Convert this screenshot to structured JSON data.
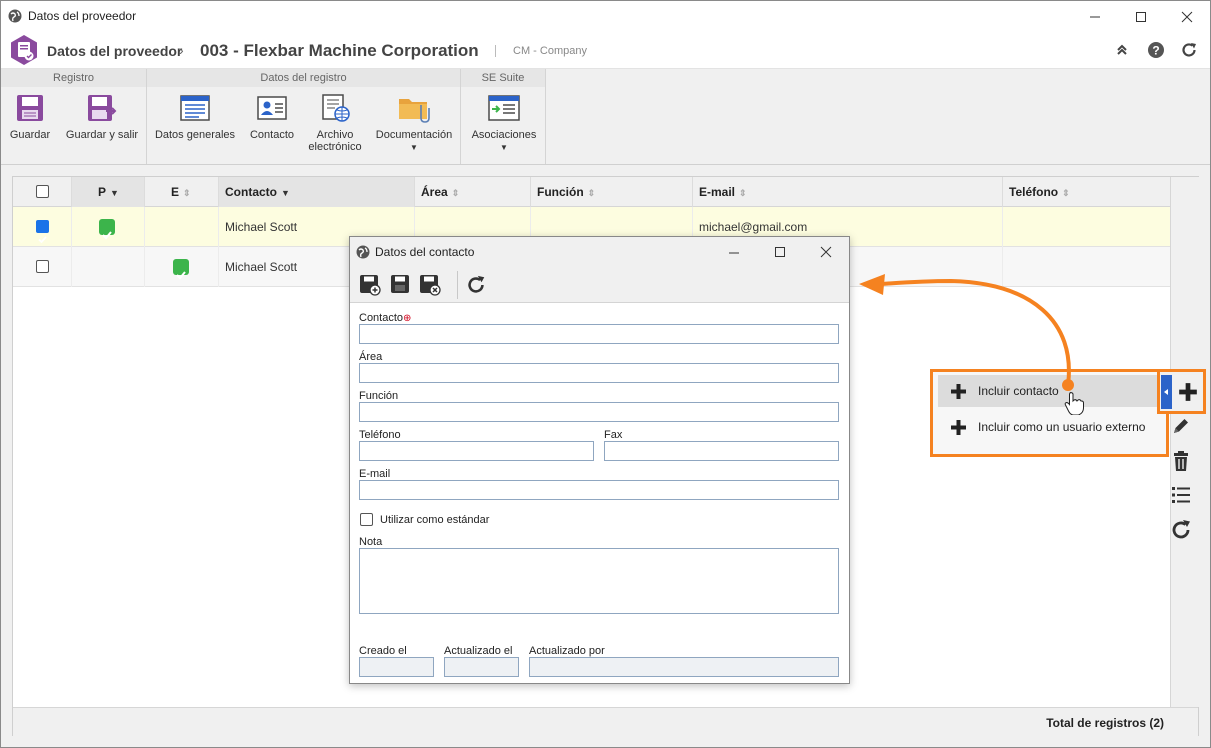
{
  "window": {
    "title": "Datos del proveedor"
  },
  "header": {
    "crumb_root": "Datos del proveedor",
    "crumb_sep": "›",
    "crumb_record": "003 - Flexbar Machine Corporation",
    "separator": "|",
    "context": "CM - Company"
  },
  "ribbon": {
    "groups": [
      {
        "title": "Registro"
      },
      {
        "title": "Datos del registro"
      },
      {
        "title": "SE Suite"
      }
    ],
    "buttons": {
      "guardar": "Guardar",
      "guardar_salir": "Guardar y salir",
      "datos_generales": "Datos generales",
      "contacto": "Contacto",
      "archivo_1": "Archivo",
      "archivo_2": "electrónico",
      "documentacion": "Documentación",
      "asociaciones": "Asociaciones"
    }
  },
  "grid": {
    "columns": {
      "p": "P",
      "e": "E",
      "contacto": "Contacto",
      "area": "Área",
      "funcion": "Función",
      "email": "E-mail",
      "telefono": "Teléfono"
    },
    "rows": [
      {
        "selected": true,
        "p": true,
        "e": false,
        "contacto": "Michael Scott",
        "email": "michael@gmail.com"
      },
      {
        "selected": false,
        "p": false,
        "e": true,
        "contacto": "Michael Scott",
        "email": ""
      }
    ],
    "footer_total": "Total de registros (2)"
  },
  "dialog": {
    "title": "Datos del contacto",
    "fields": {
      "contacto": "Contacto",
      "area": "Área",
      "funcion": "Función",
      "telefono": "Teléfono",
      "fax": "Fax",
      "email": "E-mail",
      "estandar": "Utilizar como estándar",
      "nota": "Nota",
      "creado": "Creado el",
      "actualizado": "Actualizado el",
      "actualizado_por": "Actualizado por"
    },
    "required_mark": "⊕"
  },
  "popup_menu": {
    "items": [
      {
        "label": "Incluir contacto"
      },
      {
        "label": "Incluir como un usuario externo"
      }
    ]
  },
  "colors": {
    "accent": "#f58220",
    "selected_row": "#fdfde0",
    "check_green": "#3cb44b",
    "brand_purple": "#8a4a9e"
  }
}
